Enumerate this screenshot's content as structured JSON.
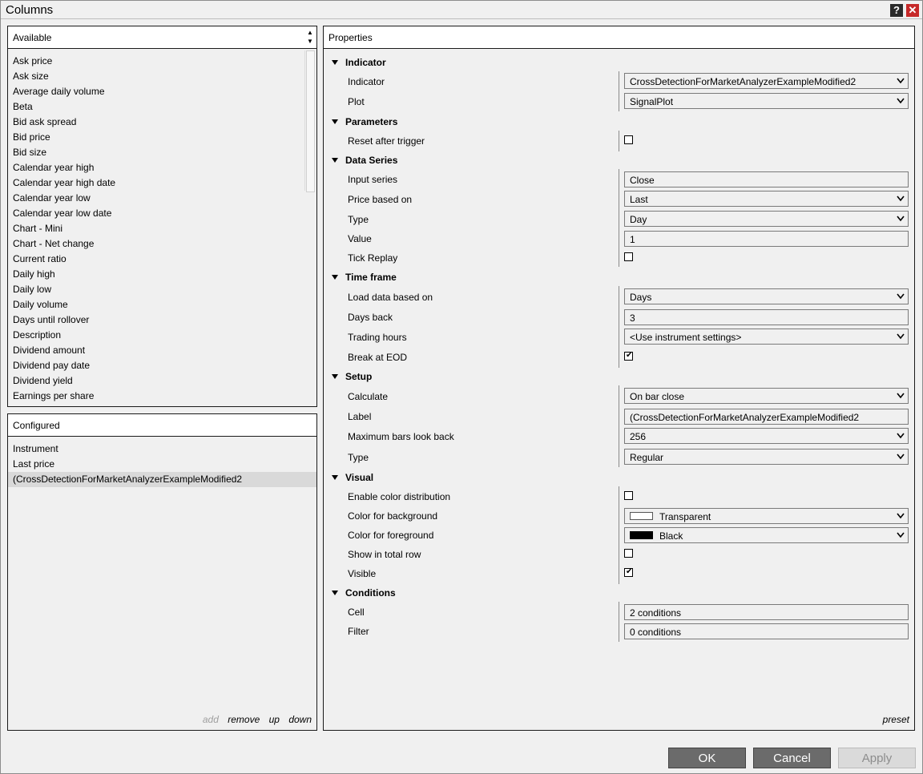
{
  "window": {
    "title": "Columns"
  },
  "available": {
    "header": "Available",
    "items": [
      "Ask price",
      "Ask size",
      "Average daily volume",
      "Beta",
      "Bid ask spread",
      "Bid price",
      "Bid size",
      "Calendar year high",
      "Calendar year high date",
      "Calendar year low",
      "Calendar year low date",
      "Chart - Mini",
      "Chart - Net change",
      "Current ratio",
      "Daily high",
      "Daily low",
      "Daily volume",
      "Days until rollover",
      "Description",
      "Dividend amount",
      "Dividend pay date",
      "Dividend yield",
      "Earnings per share"
    ]
  },
  "configured": {
    "header": "Configured",
    "items": [
      "Instrument",
      "Last price",
      "(CrossDetectionForMarketAnalyzerExampleModified2"
    ],
    "selected_index": 2,
    "actions": {
      "add": "add",
      "remove": "remove",
      "up": "up",
      "down": "down"
    }
  },
  "properties": {
    "header": "Properties",
    "preset": "preset",
    "sections": {
      "indicator": {
        "title": "Indicator",
        "indicator_label": "Indicator",
        "indicator_value": "CrossDetectionForMarketAnalyzerExampleModified2",
        "plot_label": "Plot",
        "plot_value": "SignalPlot"
      },
      "parameters": {
        "title": "Parameters",
        "reset_label": "Reset after trigger",
        "reset_checked": false
      },
      "data_series": {
        "title": "Data Series",
        "input_label": "Input series",
        "input_value": "Close",
        "price_label": "Price based on",
        "price_value": "Last",
        "type_label": "Type",
        "type_value": "Day",
        "value_label": "Value",
        "value_value": "1",
        "tick_label": "Tick Replay",
        "tick_checked": false
      },
      "time_frame": {
        "title": "Time frame",
        "load_label": "Load data based on",
        "load_value": "Days",
        "days_label": "Days back",
        "days_value": "3",
        "hours_label": "Trading hours",
        "hours_value": "<Use instrument settings>",
        "eod_label": "Break at EOD",
        "eod_checked": true
      },
      "setup": {
        "title": "Setup",
        "calc_label": "Calculate",
        "calc_value": "On bar close",
        "label_label": "Label",
        "label_value": "(CrossDetectionForMarketAnalyzerExampleModified2",
        "maxbars_label": "Maximum bars look back",
        "maxbars_value": "256",
        "type_label": "Type",
        "type_value": "Regular"
      },
      "visual": {
        "title": "Visual",
        "dist_label": "Enable color distribution",
        "dist_checked": false,
        "bg_label": "Color for background",
        "bg_value": "Transparent",
        "bg_color": "#ffffff",
        "fg_label": "Color for foreground",
        "fg_value": "Black",
        "fg_color": "#000000",
        "total_label": "Show in total row",
        "total_checked": false,
        "visible_label": "Visible",
        "visible_checked": true
      },
      "conditions": {
        "title": "Conditions",
        "cell_label": "Cell",
        "cell_value": "2 conditions",
        "filter_label": "Filter",
        "filter_value": "0 conditions"
      }
    }
  },
  "buttons": {
    "ok": "OK",
    "cancel": "Cancel",
    "apply": "Apply"
  }
}
